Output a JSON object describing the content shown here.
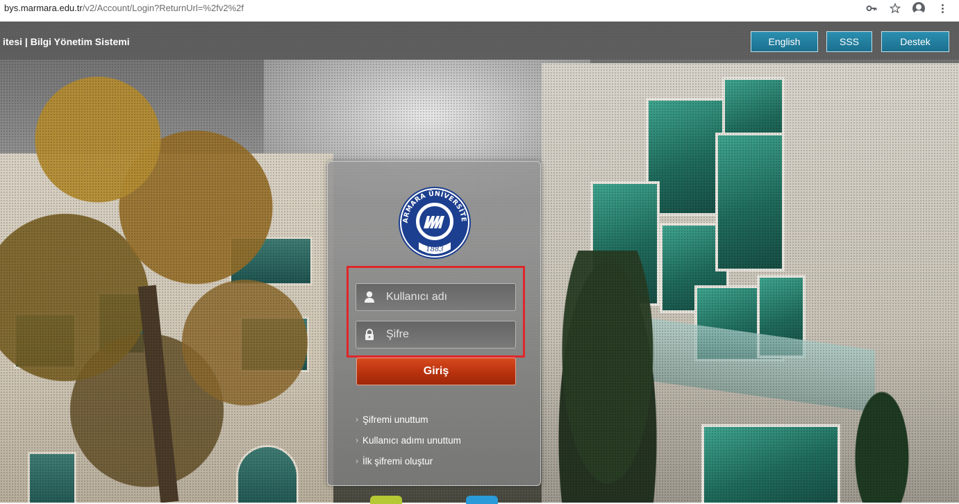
{
  "browser": {
    "url_host": "bys.marmara.edu.tr",
    "url_path": "/v2/Account/Login?ReturnUrl=%2fv2%2f",
    "icons": [
      "key-icon",
      "star-icon",
      "account-icon",
      "menu-icon"
    ]
  },
  "header": {
    "title": "itesi | Bilgi Yönetim Sistemi",
    "buttons": {
      "english": "English",
      "sss": "SSS",
      "destek": "Destek"
    }
  },
  "login": {
    "logo": {
      "arc_text": "MARMARA ÜNİVERSİTESİ",
      "year": "1883"
    },
    "username": {
      "placeholder": "Kullanıcı adı",
      "value": ""
    },
    "password": {
      "placeholder": "Şifre",
      "value": ""
    },
    "submit_label": "Giriş",
    "links": [
      {
        "label": "Şifremi unuttum"
      },
      {
        "label": "Kullanıcı adımı unuttum"
      },
      {
        "label": "İlk şifremi oluştur"
      }
    ]
  },
  "colors": {
    "header_button": "#1c6f8e",
    "login_button": "#b8320e",
    "highlight": "#e0262b",
    "logo_blue": "#1d3f8f"
  }
}
